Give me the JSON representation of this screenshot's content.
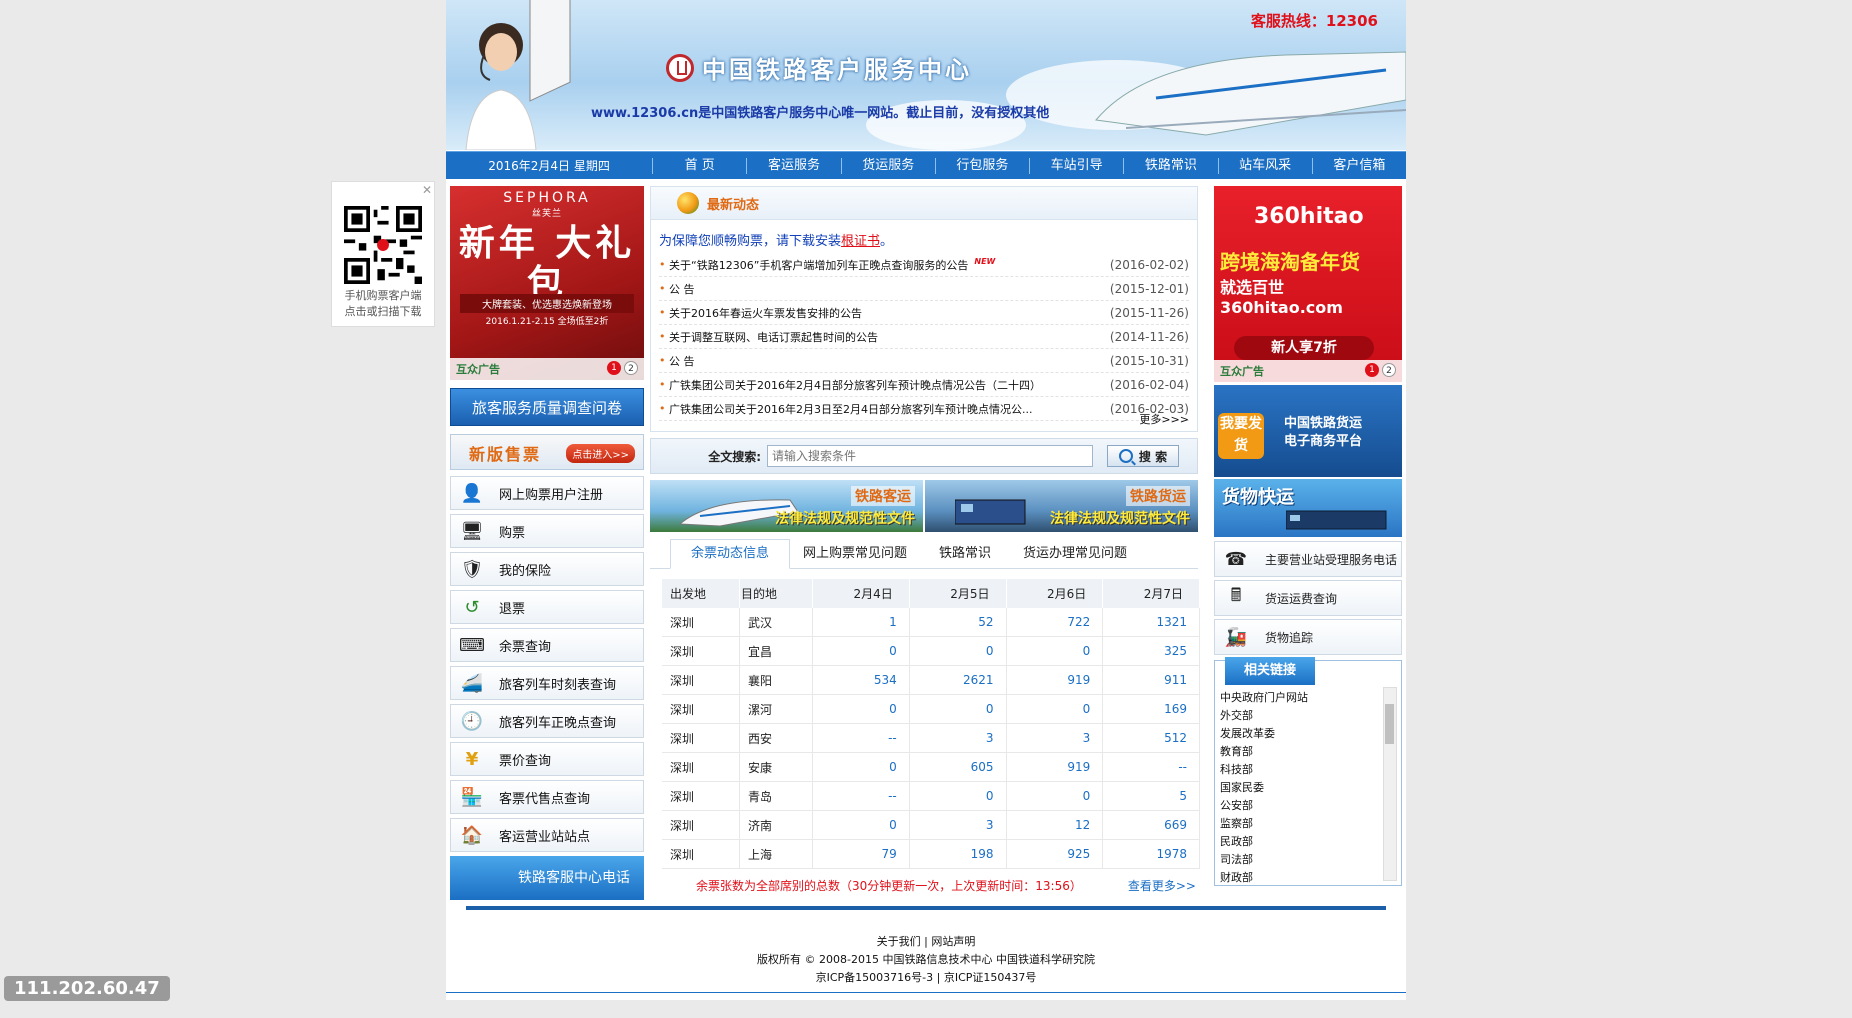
{
  "banner": {
    "hotline": "客服热线：12306",
    "logo_text": "中国铁路客户服务中心",
    "tagline_url": "www.12306.cn",
    "tagline_rest": "是中国铁路客户服务中心唯一网站。截止目前，没有授权其他"
  },
  "nav": {
    "date": "2016年2月4日 星期四",
    "items": [
      "首  页",
      "客运服务",
      "货运服务",
      "行包服务",
      "车站引导",
      "铁路常识",
      "站车风采",
      "客户信箱"
    ]
  },
  "left": {
    "ad": {
      "brand": "SEPHORA",
      "brand_cn": "丝芙兰",
      "headline": "新年 大礼包",
      "sub": "大牌套装、优选惠选焕新登场",
      "dates": "2016.1.21-2.15 全场低至2折",
      "label": "互众广告",
      "dot1": "1",
      "dot2": "2"
    },
    "survey": "旅客服务质量调查问卷",
    "newsale": "新版售票",
    "newsale_btn": "点击进入>>",
    "menu": [
      {
        "label": "网上购票用户注册",
        "icon": "user-register-icon",
        "glyph": "👤"
      },
      {
        "label": "购票",
        "icon": "ticket-icon",
        "glyph": "🖥"
      },
      {
        "label": "我的保险",
        "icon": "insurance-icon",
        "glyph": "🛡"
      },
      {
        "label": "退票",
        "icon": "refund-icon",
        "glyph": "↺"
      },
      {
        "label": "余票查询",
        "icon": "keyboard-icon",
        "glyph": "⌨"
      },
      {
        "label": "旅客列车时刻表查询",
        "icon": "train-icon",
        "glyph": "🚄"
      },
      {
        "label": "旅客列车正晚点查询",
        "icon": "clock-icon",
        "glyph": "🕘"
      },
      {
        "label": "票价查询",
        "icon": "price-icon",
        "glyph": "¥"
      },
      {
        "label": "客票代售点查询",
        "icon": "shop-icon",
        "glyph": "🏪"
      },
      {
        "label": "客运营业站站点",
        "icon": "station-icon",
        "glyph": "🏠"
      }
    ],
    "phone": "铁路客服中心电话"
  },
  "news": {
    "title": "最新动态",
    "notice_prefix": "为保障您顺畅购票，请下载安装",
    "notice_link": "根证书",
    "notice_suffix": "。",
    "items": [
      {
        "text": "关于“铁路12306”手机客户端增加列车正晚点查询服务的公告",
        "date": "(2016-02-02)",
        "new": "NEW"
      },
      {
        "text": "公 告",
        "date": "(2015-12-01)",
        "new": ""
      },
      {
        "text": "关于2016年春运火车票发售安排的公告",
        "date": "(2015-11-26)",
        "new": ""
      },
      {
        "text": "关于调整互联网、电话订票起售时间的公告",
        "date": "(2014-11-26)",
        "new": ""
      },
      {
        "text": "公 告",
        "date": "(2015-10-31)",
        "new": ""
      },
      {
        "text": "广铁集团公司关于2016年2月4日部分旅客列车预计晚点情况公告（二十四）",
        "date": "(2016-02-04)",
        "new": ""
      },
      {
        "text": "广铁集团公司关于2016年2月3日至2月4日部分旅客列车预计晚点情况公...",
        "date": "(2016-02-03)",
        "new": ""
      }
    ],
    "more": "更多>>>"
  },
  "search": {
    "label": "全文搜索:",
    "placeholder": "请输入搜索条件",
    "button": "搜 索"
  },
  "mid_banners": {
    "passenger_tag": "铁路客运",
    "freight_tag": "铁路货运",
    "law": "法律法规及规范性文件"
  },
  "tabs": [
    "余票动态信息",
    "网上购票常见问题",
    "铁路常识",
    "货运办理常见问题"
  ],
  "ticket_table": {
    "headers": [
      "出发地",
      "目的地",
      "2月4日",
      "2月5日",
      "2月6日",
      "2月7日"
    ],
    "rows": [
      [
        "深圳",
        "武汉",
        "1",
        "52",
        "722",
        "1321"
      ],
      [
        "深圳",
        "宜昌",
        "0",
        "0",
        "0",
        "325"
      ],
      [
        "深圳",
        "襄阳",
        "534",
        "2621",
        "919",
        "911"
      ],
      [
        "深圳",
        "漯河",
        "0",
        "0",
        "0",
        "169"
      ],
      [
        "深圳",
        "西安",
        "--",
        "3",
        "3",
        "512"
      ],
      [
        "深圳",
        "安康",
        "0",
        "605",
        "919",
        "--"
      ],
      [
        "深圳",
        "青岛",
        "--",
        "0",
        "0",
        "5"
      ],
      [
        "深圳",
        "济南",
        "0",
        "3",
        "12",
        "669"
      ],
      [
        "深圳",
        "上海",
        "79",
        "198",
        "925",
        "1978"
      ]
    ],
    "footnote": "余票张数为全部席别的总数（30分钟更新一次，上次更新时间：13:56）",
    "more": "查看更多>>"
  },
  "right": {
    "ad": {
      "logo": "360hitao",
      "line1": "跨境海淘备年货",
      "line2": "就选百世360hitao.com",
      "pill": "新人享7折",
      "label": "互众广告",
      "dot1": "1",
      "dot2": "2"
    },
    "freight": {
      "badge": "我要发货",
      "title1": "中国铁路货运",
      "title2": "电子商务平台"
    },
    "express": "货物快运",
    "menu": [
      {
        "label": "主要营业站受理服务电话",
        "icon": "phone-icon",
        "glyph": "☎"
      },
      {
        "label": "货运运费查询",
        "icon": "calculator-icon",
        "glyph": "🖩"
      },
      {
        "label": "货物追踪",
        "icon": "locomotive-icon",
        "glyph": "🚂"
      }
    ],
    "links_title": "相关链接",
    "links": [
      "中央政府门户网站",
      "外交部",
      "发展改革委",
      "教育部",
      "科技部",
      "国家民委",
      "公安部",
      "监察部",
      "民政部",
      "司法部",
      "财政部"
    ]
  },
  "footer": {
    "line1": "关于我们 | 网站声明",
    "line2": "版权所有 © 2008-2015 中国铁路信息技术中心 中国铁道科学研究院",
    "line3": "京ICP备15003716号-3  |  京ICP证150437号"
  },
  "qr": {
    "caption1": "手机购票客户端",
    "caption2": "点击或扫描下载"
  },
  "ip": "111.202.60.47",
  "colors": {
    "primary": "#1b6fc4",
    "accent": "#e06a14",
    "alert": "#e0101a"
  }
}
